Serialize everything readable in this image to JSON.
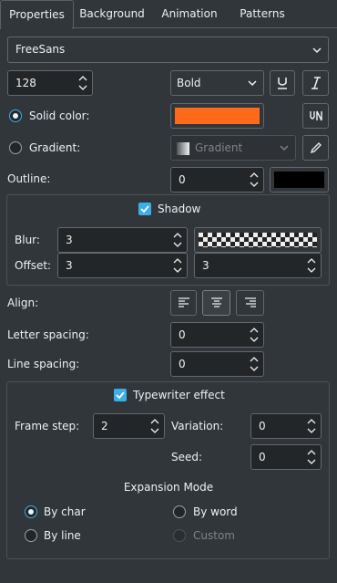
{
  "tabs": [
    "Properties",
    "Background",
    "Animation",
    "Patterns"
  ],
  "font": {
    "family": "FreeSans",
    "size": "128",
    "weight": "Bold"
  },
  "fill": {
    "solid_label": "Solid color:",
    "solid_color": "#ff6a1a",
    "gradient_label": "Gradient:",
    "gradient_value": "Gradient"
  },
  "outline": {
    "label": "Outline:",
    "value": "0",
    "color": "#000000"
  },
  "shadow": {
    "label": "Shadow",
    "blur_label": "Blur:",
    "blur_value": "3",
    "offset_label": "Offset:",
    "offset_x": "3",
    "offset_y": "3"
  },
  "align": {
    "label": "Align:"
  },
  "letter_spacing": {
    "label": "Letter spacing:",
    "value": "0"
  },
  "line_spacing": {
    "label": "Line spacing:",
    "value": "0"
  },
  "typewriter": {
    "label": "Typewriter effect",
    "frame_step_label": "Frame step:",
    "frame_step_value": "2",
    "variation_label": "Variation:",
    "variation_value": "0",
    "seed_label": "Seed:",
    "seed_value": "0",
    "expansion_title": "Expansion Mode",
    "modes": {
      "by_char": "By char",
      "by_word": "By word",
      "by_line": "By line",
      "custom": "Custom"
    }
  },
  "colors": {
    "accent": "#3daee9",
    "background": "#31363b",
    "field": "#232629"
  }
}
